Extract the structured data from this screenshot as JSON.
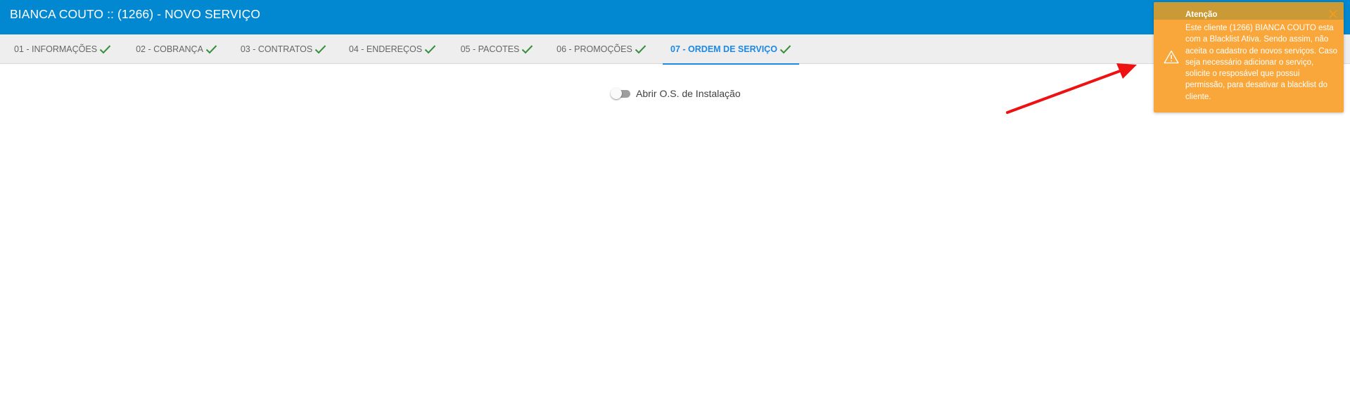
{
  "header": {
    "title": "BIANCA COUTO :: (1266) - NOVO SERVIÇO"
  },
  "tabs": [
    {
      "label": "01 - INFORMAÇÕES",
      "completed": true,
      "active": false
    },
    {
      "label": "02 - COBRANÇA",
      "completed": true,
      "active": false
    },
    {
      "label": "03 - CONTRATOS",
      "completed": true,
      "active": false
    },
    {
      "label": "04 - ENDEREÇOS",
      "completed": true,
      "active": false
    },
    {
      "label": "05 - PACOTES",
      "completed": true,
      "active": false
    },
    {
      "label": "06 - PROMOÇÕES",
      "completed": true,
      "active": false
    },
    {
      "label": "07 - ORDEM DE SERVIÇO",
      "completed": true,
      "active": true
    }
  ],
  "install_toggle": {
    "label": "Abrir O.S. de Instalação",
    "checked": false
  },
  "toast": {
    "title": "Atenção",
    "message": "Este cliente (1266) BIANCA COUTO esta com a Blacklist Ativa. Sendo assim, não aceita o cadastro de novos serviços. Caso seja necessário adicionar o serviço, solicite o resposável que possui permissão, para desativar a blacklist do cliente.",
    "icon": "warning-icon",
    "close_icon": "close-icon"
  },
  "colors": {
    "header_bg": "#0288d1",
    "tab_active": "#1e88e5",
    "check": "#388e3c",
    "toast_bg": "#f9a73a",
    "annotation_arrow": "#ee1111"
  }
}
